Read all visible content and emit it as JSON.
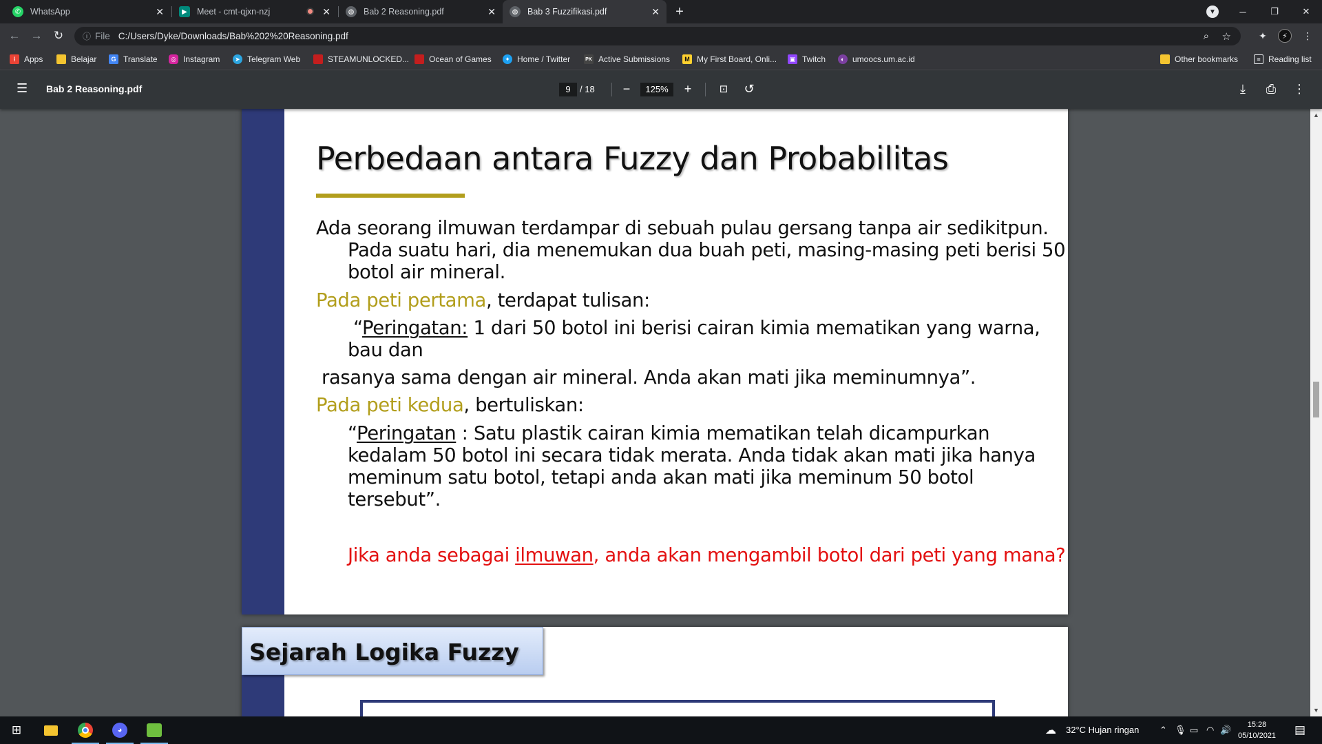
{
  "browser": {
    "tabs": [
      {
        "title": "WhatsApp",
        "icon": "whatsapp-icon",
        "color": "#25d366",
        "active": false
      },
      {
        "title": "Meet - cmt-qjxn-nzj",
        "icon": "meet-icon",
        "color": "#00897b",
        "active": false
      },
      {
        "title": "Bab 2 Reasoning.pdf",
        "icon": "globe-icon",
        "color": "#9aa0a6",
        "active": false
      },
      {
        "title": "Bab 3 Fuzzifikasi.pdf",
        "icon": "globe-icon",
        "color": "#9aa0a6",
        "active": true
      }
    ],
    "address": {
      "scheme_label": "File",
      "url": "C:/Users/Dyke/Downloads/Bab%202%20Reasoning.pdf"
    },
    "bookmarks": [
      {
        "label": "Apps",
        "icon": "apps-grid-icon",
        "color": "#ea4335"
      },
      {
        "label": "Belajar",
        "icon": "folder-icon",
        "color": "#f4c430"
      },
      {
        "label": "Translate",
        "icon": "translate-icon",
        "color": "#4285f4"
      },
      {
        "label": "Instagram",
        "icon": "instagram-icon",
        "color": "#d6249f"
      },
      {
        "label": "Telegram Web",
        "icon": "telegram-icon",
        "color": "#2ca5e0"
      },
      {
        "label": "STEAMUNLOCKED...",
        "icon": "steam-icon",
        "color": "#c41e1e"
      },
      {
        "label": "Ocean of Games",
        "icon": "ocean-icon",
        "color": "#c41e1e"
      },
      {
        "label": "Home / Twitter",
        "icon": "twitter-icon",
        "color": "#1da1f2"
      },
      {
        "label": "Active Submissions",
        "icon": "pk-icon",
        "color": "#444444"
      },
      {
        "label": "My First Board, Onli...",
        "icon": "miro-icon",
        "color": "#ffd02f"
      },
      {
        "label": "Twitch",
        "icon": "twitch-icon",
        "color": "#9146ff"
      },
      {
        "label": "umoocs.um.ac.id",
        "icon": "umoocs-icon",
        "color": "#7b3fa0"
      },
      {
        "label": "Other bookmarks",
        "icon": "folder-icon",
        "color": "#f4c430"
      },
      {
        "label": "Reading list",
        "icon": "reading-list-icon",
        "color": "#e8eaed"
      }
    ]
  },
  "pdf": {
    "title": "Bab 2 Reasoning.pdf",
    "page_current": "9",
    "page_total": "/ 18",
    "zoom": "125%"
  },
  "slide": {
    "title": "Perbedaan antara Fuzzy dan Probabilitas",
    "p1_line1": "Ada seorang ilmuwan terdampar di sebuah pulau gersang tanpa air sedikitpun.",
    "p1_line2": "Pada suatu hari, dia menemukan dua buah peti, masing-masing peti berisi 50",
    "p1_line3": "botol air mineral.",
    "peti1_label": "Pada peti pertama",
    "peti1_rest": ", terdapat tulisan:",
    "warn1_open": "“",
    "warn1_word": "Peringatan:",
    "warn1_rest": " 1 dari 50 botol ini berisi cairan kimia mematikan yang warna,",
    "warn1_line2": "bau dan",
    "warn1_line3": "rasanya sama dengan air mineral. Anda akan mati jika meminumnya”.",
    "peti2_label": "Pada peti kedua",
    "peti2_rest": ", bertuliskan:",
    "warn2_open": "“",
    "warn2_word": "Peringatan",
    "warn2_rest": " : Satu plastik cairan kimia mematikan telah dicampurkan",
    "warn2_line2": "kedalam 50 botol ini secara tidak merata. Anda tidak akan mati jika hanya",
    "warn2_line3": "meminum satu botol, tetapi anda akan mati jika meminum 50 botol",
    "warn2_line4": "tersebut”.",
    "q_pre": "Jika anda sebagai ",
    "q_word": "ilmuwan",
    "q_post": ", anda akan mengambil botol dari peti yang mana?"
  },
  "slide2": {
    "title": "Sejarah Logika Fuzzy"
  },
  "taskbar": {
    "weather": "32°C  Hujan ringan",
    "time": "15:28",
    "date": "05/10/2021"
  },
  "colors": {
    "slide_left_bar": "#2e3a78",
    "gold": "#b29e1c",
    "question_red": "#e31010"
  }
}
